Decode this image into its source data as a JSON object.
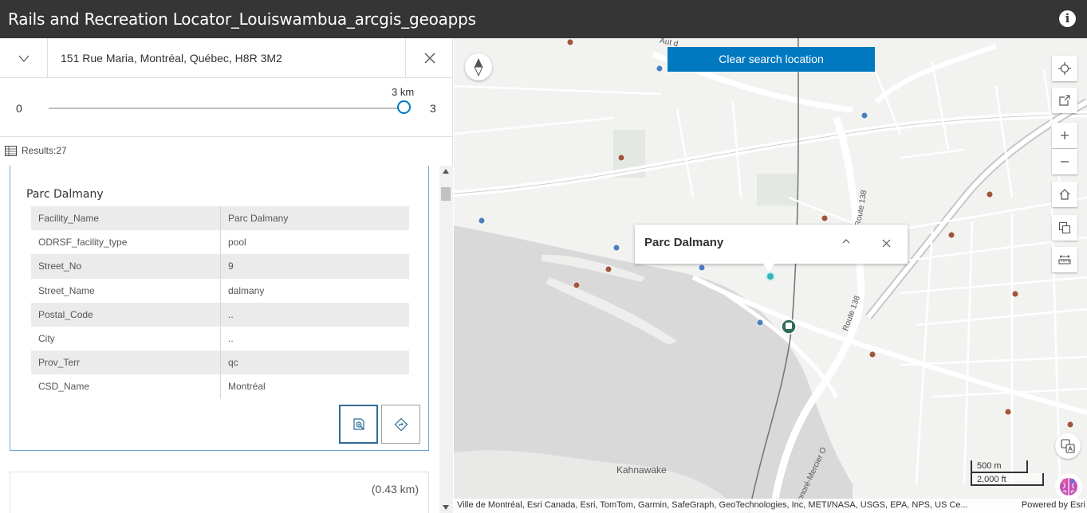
{
  "app": {
    "title": "Rails and Recreation Locator_Louiswambua_arcgis_geoapps",
    "info_icon": "info-icon"
  },
  "search": {
    "value": "151 Rue Maria, Montréal, Québec, H8R 3M2",
    "toggle_icon": "chevron-down-icon",
    "clear_icon": "close-icon"
  },
  "slider": {
    "min_label": "0",
    "max_label": "3",
    "value_label": "3 km",
    "value": 3,
    "min": 0,
    "max": 3
  },
  "results": {
    "label": "Results:27",
    "icon": "table-icon"
  },
  "feature": {
    "title": "Parc Dalmany",
    "fields": [
      {
        "key": "Facility_Name",
        "value": "Parc Dalmany"
      },
      {
        "key": "ODRSF_facility_type",
        "value": "pool"
      },
      {
        "key": "Street_No",
        "value": "9"
      },
      {
        "key": "Street_Name",
        "value": "dalmany"
      },
      {
        "key": "Postal_Code",
        "value": ".."
      },
      {
        "key": "City",
        "value": ".."
      },
      {
        "key": "Prov_Terr",
        "value": "qc"
      },
      {
        "key": "CSD_Name",
        "value": "Montréal"
      }
    ],
    "actions": [
      "zoom-to-icon",
      "directions-icon"
    ]
  },
  "next_result": {
    "distance": "(0.43 km)"
  },
  "map": {
    "clear_button": "Clear search location",
    "popup_title": "Parc Dalmany",
    "place_label": "Kahnawake",
    "road_label_1": "Route 138",
    "road_label_2": "Route 138",
    "road_label_3": "Honoré-Mercier O",
    "road_label_4": "Aut d",
    "scale_metric": "500 m",
    "scale_imperial": "2,000 ft",
    "attribution": "Ville de Montréal, Esri Canada, Esri, TomTom, Garmin, SafeGraph, GeoTechnologies, Inc, METI/NASA, USGS, EPA, NPS, US Ce...",
    "powered_by": "Powered by Esri",
    "tools": [
      "locate-icon",
      "share-icon",
      "zoom-in-icon",
      "zoom-out-icon",
      "home-icon",
      "basemap-gallery-icon",
      "measure-icon"
    ],
    "colors": {
      "brand_blue": "#0079c1",
      "rec_point": "#a0563c",
      "rail_point": "#4c7fbf",
      "selected": "#38b2b2"
    }
  }
}
